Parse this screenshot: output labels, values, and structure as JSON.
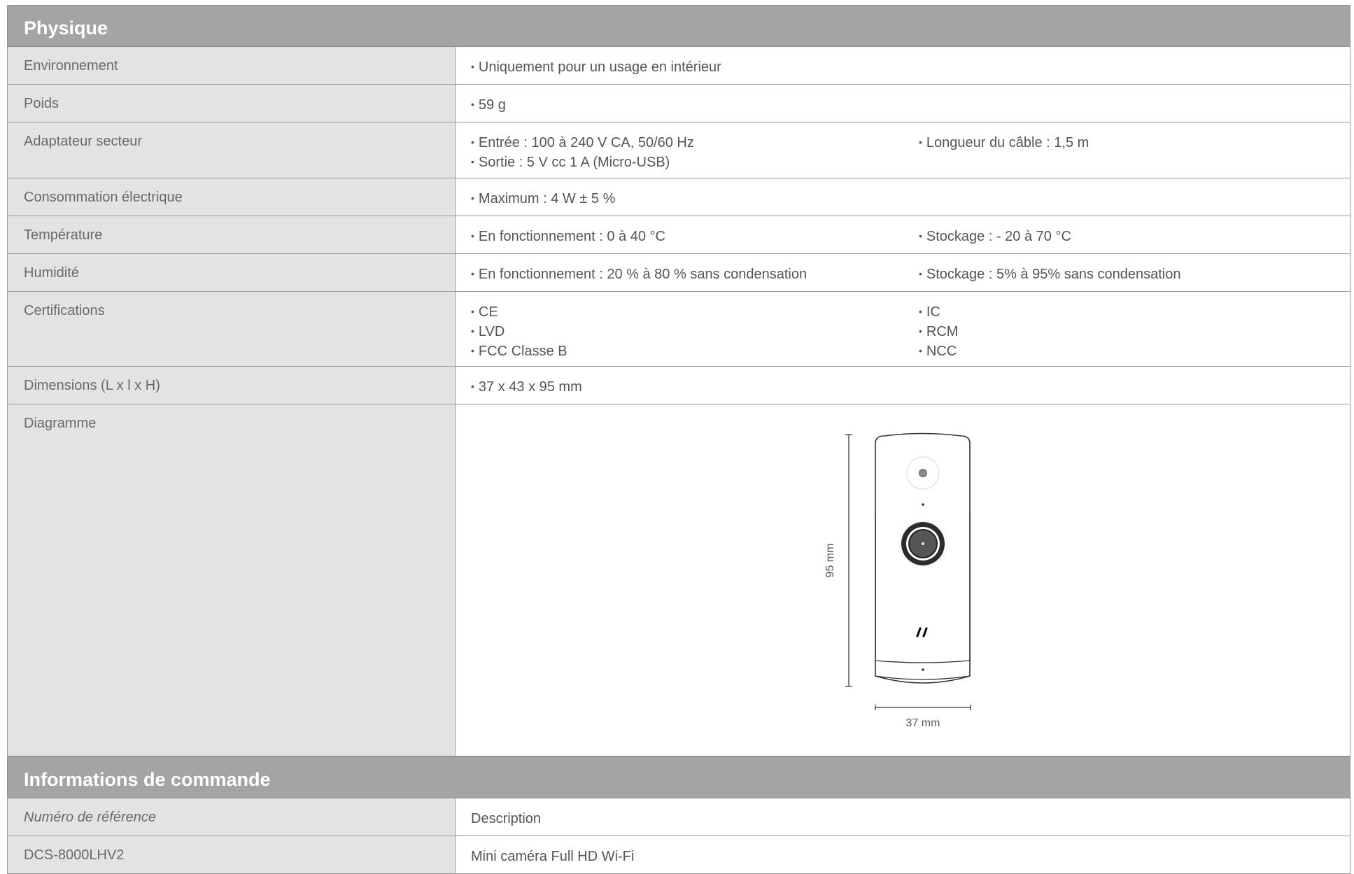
{
  "physique": {
    "title": "Physique",
    "rows": {
      "environnement": {
        "label": "Environnement",
        "values": [
          "Uniquement pour un usage en intérieur"
        ]
      },
      "poids": {
        "label": "Poids",
        "values": [
          "59 g"
        ]
      },
      "adaptateur": {
        "label": "Adaptateur secteur",
        "col1": [
          "Entrée : 100 à 240 V CA, 50/60 Hz",
          "Sortie : 5 V cc 1 A (Micro-USB)"
        ],
        "col2": [
          "Longueur du câble : 1,5 m"
        ]
      },
      "consommation": {
        "label": "Consommation électrique",
        "values": [
          "Maximum :  4 W ± 5 %"
        ]
      },
      "temperature": {
        "label": "Température",
        "col1": [
          "En fonctionnement : 0 à 40 °C"
        ],
        "col2": [
          "Stockage : - 20 à 70 °C"
        ]
      },
      "humidite": {
        "label": "Humidité",
        "col1": [
          "En fonctionnement : 20 % à 80 % sans condensation"
        ],
        "col2": [
          "Stockage : 5% à 95% sans condensation"
        ]
      },
      "certifications": {
        "label": "Certifications",
        "col1": [
          "CE",
          "LVD",
          "FCC Classe B"
        ],
        "col2": [
          "IC",
          "RCM",
          "NCC"
        ]
      },
      "dimensions": {
        "label": "Dimensions (L x l x H)",
        "values": [
          "37 x 43 x 95 mm"
        ]
      },
      "diagramme": {
        "label": "Diagramme",
        "height_label": "95 mm",
        "width_label": "37 mm"
      }
    }
  },
  "commande": {
    "title": "Informations de commande",
    "header": {
      "ref": "Numéro de référence",
      "desc": "Description"
    },
    "items": [
      {
        "ref": "DCS-8000LHV2",
        "desc": "Mini caméra Full HD Wi-Fi"
      }
    ]
  }
}
